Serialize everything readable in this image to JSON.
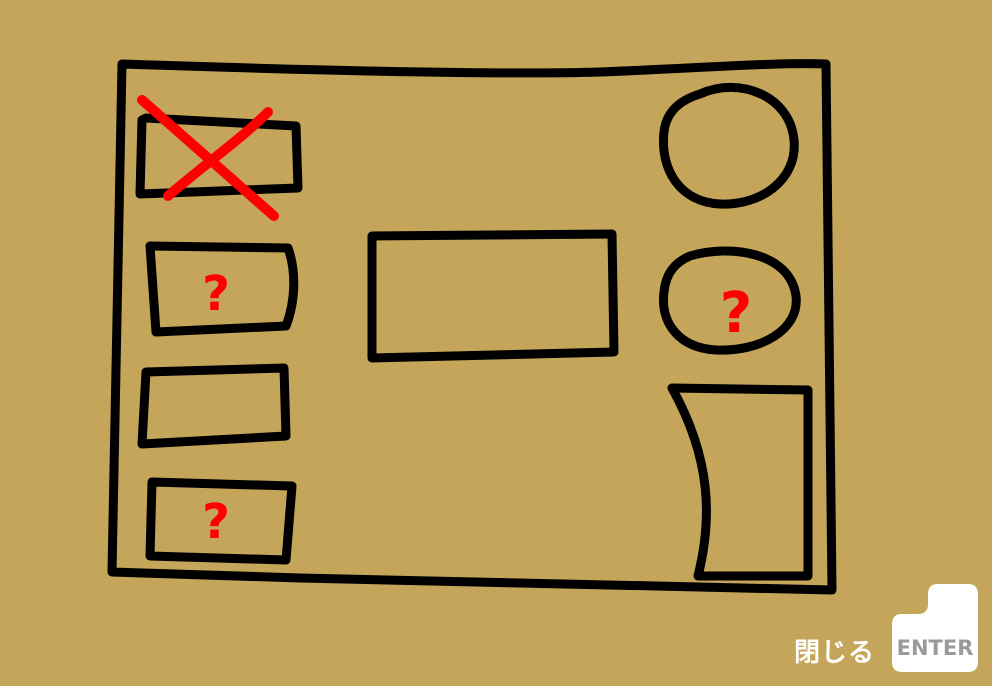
{
  "hud": {
    "close_label": "閉じる",
    "enter_key_label": "ENTER"
  },
  "colors": {
    "background": "#C4A55A",
    "ink": "#000000",
    "mark": "#FF0000",
    "key_face": "#FFFFFF"
  },
  "sketch": {
    "slots": [
      {
        "name": "crossed-out",
        "mark": "X"
      },
      {
        "name": "unknown",
        "mark": "?"
      },
      {
        "name": "empty",
        "mark": ""
      },
      {
        "name": "unknown",
        "mark": "?"
      },
      {
        "name": "center-panel",
        "mark": ""
      },
      {
        "name": "round-top",
        "mark": ""
      },
      {
        "name": "round-unknown",
        "mark": "?"
      },
      {
        "name": "tall-panel",
        "mark": ""
      }
    ]
  }
}
